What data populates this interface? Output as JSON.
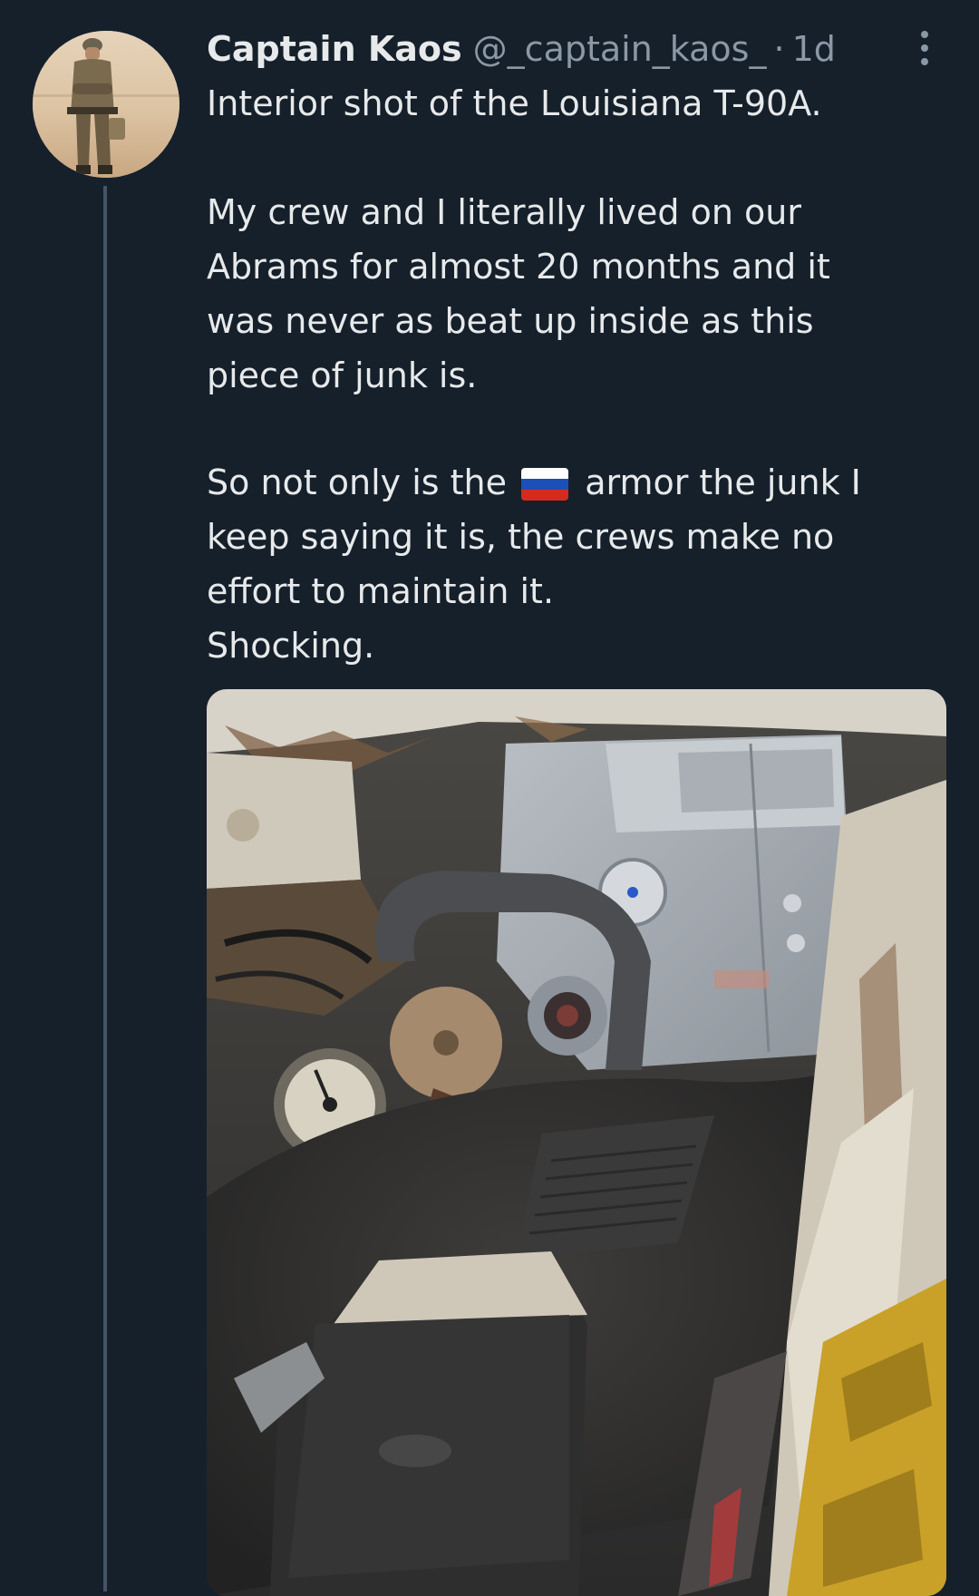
{
  "tweet": {
    "author_name": "Captain Kaos",
    "handle": "@_captain_kaos_",
    "separator": "·",
    "time": "1d",
    "lines": {
      "p1": "Interior shot of the Louisiana T-90A.",
      "p2_l1": "My crew and I literally lived on our",
      "p2_l2": "Abrams for almost 20 months and it",
      "p2_l3": "was never as beat up inside as this",
      "p2_l4": "piece of junk is.",
      "p3_l1_before": "So not only is the",
      "p3_l1_after": "armor the junk I",
      "p3_l2": "keep saying it is, the crews make no",
      "p3_l3": "effort to maintain it.",
      "p3_l4": "Shocking."
    },
    "flag_emoji": "russia-flag",
    "colors": {
      "background": "#15202b",
      "text": "#e7e9ea",
      "muted": "#8b98a5",
      "thread_line": "#425466"
    }
  }
}
